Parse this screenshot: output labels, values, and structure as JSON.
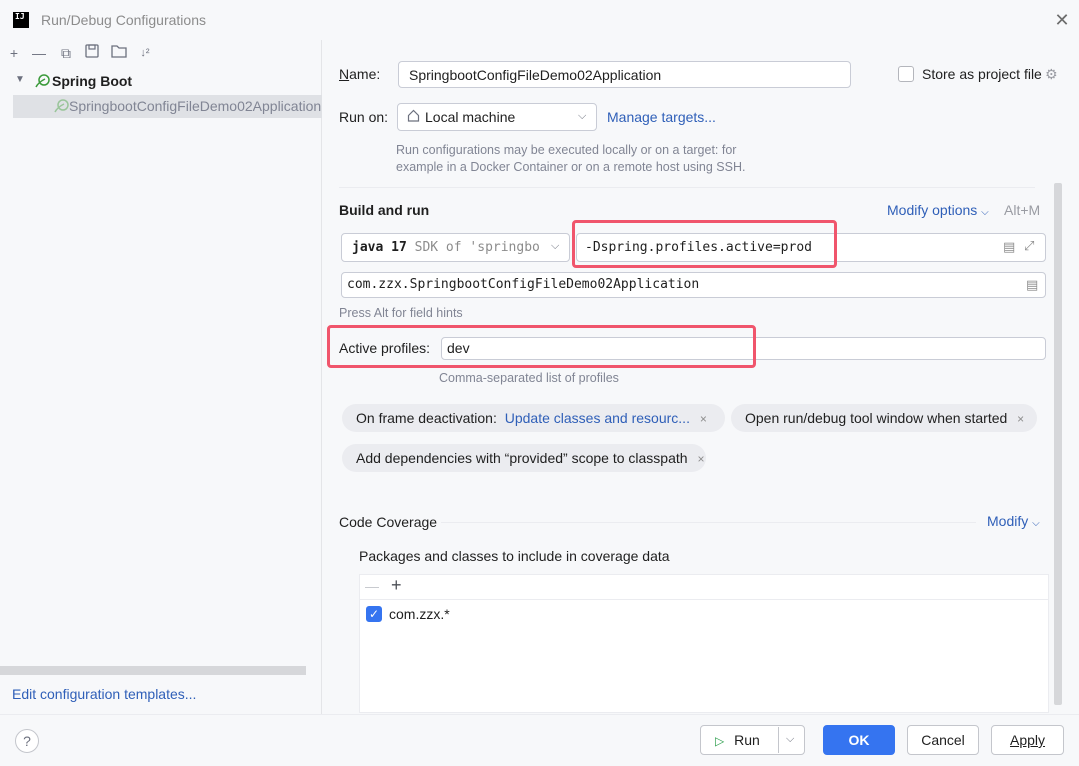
{
  "window": {
    "title": "Run/Debug Configurations",
    "logo_text": "IJ"
  },
  "toolbar": {
    "add": "+",
    "remove": "—",
    "copy": "⧉",
    "save": "💾",
    "folder": "🗀",
    "sort": "↓²"
  },
  "tree": {
    "root_label": "Spring Boot",
    "child_label": "SpringbootConfigFileDemo02Application"
  },
  "left_footer": {
    "edit_templates": "Edit configuration templates..."
  },
  "form": {
    "name_label": "Name:",
    "name_value": "SpringbootConfigFileDemo02Application",
    "store_label": "Store as project file",
    "run_on_label": "Run on:",
    "run_on_value": "Local machine",
    "manage_targets": "Manage targets...",
    "run_on_hint": "Run configurations may be executed locally or on a target: for example in a Docker Container or on a remote host using SSH.",
    "build_run_title": "Build and run",
    "modify_options": "Modify options",
    "modify_shortcut": "Alt+M",
    "jdk_bold": "java 17",
    "jdk_rest": "SDK of 'springbo",
    "vm_options": "-Dspring.profiles.active=prod",
    "main_class": "com.zzx.SpringbootConfigFileDemo02Application",
    "field_hints": "Press Alt for field hints",
    "active_profiles_label": "Active profiles:",
    "active_profiles_value": "dev",
    "profiles_hint": "Comma-separated list of profiles"
  },
  "chips": {
    "frame_label": "On frame deactivation:",
    "frame_value": "Update classes and resourc...",
    "open_tool": "Open run/debug tool window when started",
    "provided": "Add dependencies with “provided” scope to classpath",
    "close": "×"
  },
  "coverage": {
    "title": "Code Coverage",
    "modify": "Modify",
    "packages_title": "Packages and classes to include in coverage data",
    "item": "com.zzx.*"
  },
  "buttons": {
    "run": "Run",
    "ok": "OK",
    "cancel": "Cancel",
    "apply": "Apply",
    "help": "?"
  }
}
